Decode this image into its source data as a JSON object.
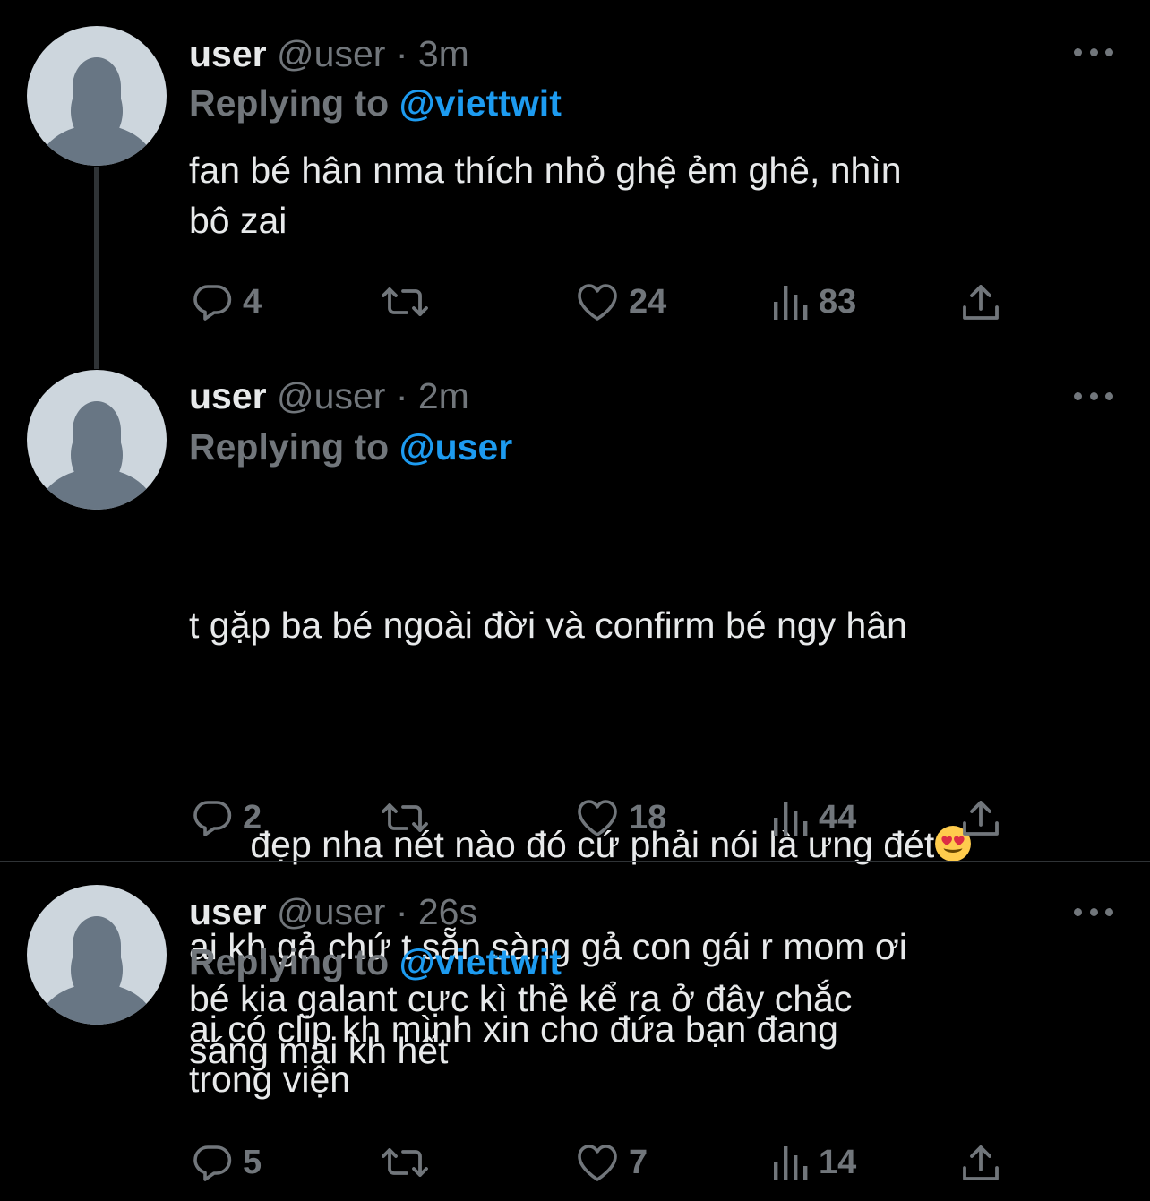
{
  "colors": {
    "background": "#000000",
    "text_primary": "#e7e9ea",
    "text_secondary": "#71767b",
    "accent": "#1d9bf0",
    "divider": "#2f3336",
    "avatar_bg": "#cdd6dd",
    "avatar_fg": "#687684"
  },
  "tweets": [
    {
      "name": "user",
      "handle": "@user",
      "separator": "·",
      "time": "3m",
      "replying_prefix": "Replying to",
      "replying_to": "@viettwit",
      "text": "fan bé hân nma thích nhỏ ghệ ẻm ghê, nhìn\nbô zai",
      "replies": "4",
      "retweets": "",
      "likes": "24",
      "views": "83",
      "icons": [
        "reply-icon",
        "retweet-icon",
        "like-icon",
        "views-icon",
        "share-icon",
        "more-icon"
      ]
    },
    {
      "name": "user",
      "handle": "@user",
      "separator": "·",
      "time": "2m",
      "replying_prefix": "Replying to",
      "replying_to": "@user",
      "text_line1": "t gặp ba bé ngoài đời và confirm bé ngy hân",
      "text_line2": "đẹp nha nét nào đó cứ phải nói là ưng đét",
      "emoji": "😍",
      "text_rest": "ai kh gả chứ t sẵn sàng gả con gái r mom ơi\nbé kia galant cực kì thề kể ra ở đây chắc\nsáng mai kh hết",
      "replies": "2",
      "retweets": "",
      "likes": "18",
      "views": "44",
      "icons": [
        "reply-icon",
        "retweet-icon",
        "like-icon",
        "views-icon",
        "share-icon",
        "more-icon"
      ]
    },
    {
      "name": "user",
      "handle": "@user",
      "separator": "·",
      "time": "26s",
      "replying_prefix": "Replying to",
      "replying_to": "@viettwit",
      "text": "ai có clip kh mình xin cho đứa bạn đang\ntrong viện",
      "replies": "5",
      "retweets": "",
      "likes": "7",
      "views": "14",
      "icons": [
        "reply-icon",
        "retweet-icon",
        "like-icon",
        "views-icon",
        "share-icon",
        "more-icon"
      ]
    }
  ]
}
